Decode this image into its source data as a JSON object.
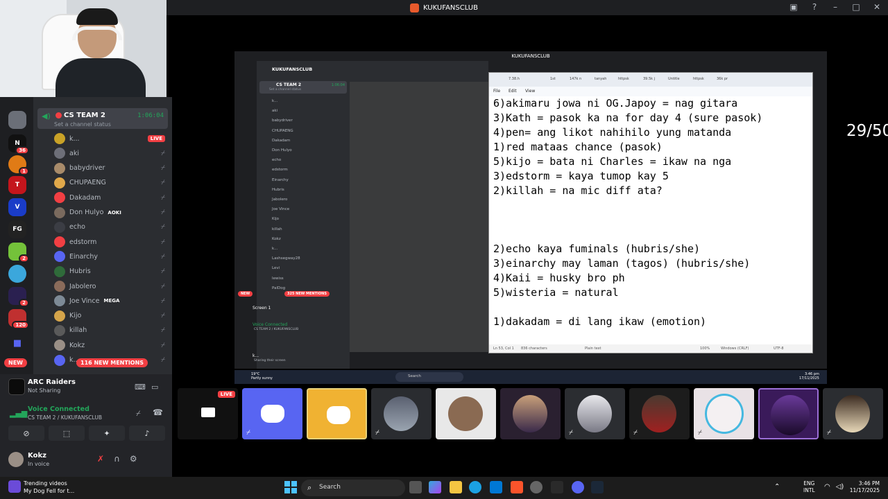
{
  "window": {
    "title": "KUKUFANSCLUB"
  },
  "sidebar": {
    "channel": {
      "name": "CS TEAM 2",
      "status": "Set a channel status",
      "time": "1:06:04"
    },
    "members": [
      {
        "name": "k...",
        "live": "LIVE",
        "color": "#c9a227"
      },
      {
        "name": "aki",
        "color": "#6d6f78"
      },
      {
        "name": "babydriver",
        "color": "#a88b6a"
      },
      {
        "name": "CHUPAENG",
        "color": "#e0a84a"
      },
      {
        "name": "Dakadam",
        "color": "#f23f43"
      },
      {
        "name": "Don Hulyo",
        "tag": "AOKI",
        "color": "#7a6a5e"
      },
      {
        "name": "echo",
        "color": "#3b3d44"
      },
      {
        "name": "edstorm",
        "color": "#f23f43"
      },
      {
        "name": "Einarchy",
        "color": "#5865f2"
      },
      {
        "name": "Hubris",
        "color": "#2f6b3a"
      },
      {
        "name": "Jabolero",
        "color": "#8a6b5a"
      },
      {
        "name": "Joe Vince",
        "tag": "MEGA",
        "color": "#7d8a96"
      },
      {
        "name": "Kijo",
        "color": "#d4a44a"
      },
      {
        "name": "killah",
        "color": "#5a5a5a"
      },
      {
        "name": "Kokz",
        "color": "#9a8f86"
      },
      {
        "name": "k...",
        "color": "#5865f2"
      }
    ],
    "new_label": "NEW",
    "mentions": "116 NEW MENTIONS",
    "server_badges": [
      "36",
      "1",
      "2",
      "2",
      "2",
      "120"
    ]
  },
  "activity": {
    "title": "ARC Raiders",
    "subtitle": "Not Sharing"
  },
  "voice": {
    "status": "Voice Connected",
    "channel": "CS TEAM 2 / KUKUFANSCLUB"
  },
  "user": {
    "name": "Kokz",
    "status": "In voice"
  },
  "shared": {
    "title": "KUKUFANSCLUB",
    "server": "KUKUFANSCLUB",
    "channel": "CS TEAM 2",
    "channel_status": "Set a channel status",
    "time": "1:06:04",
    "members": [
      "k...",
      "aki",
      "babydriver",
      "CHUPAENG",
      "Dakadam",
      "Don Hulyo",
      "echo",
      "edstorm",
      "Einarchy",
      "Hubris",
      "Jabolero",
      "Joe Vince",
      "Kijo",
      "killah",
      "Kokz",
      "k...",
      "Lashsegway28",
      "Levi",
      "lewiss",
      "PalDog"
    ],
    "mentions": "325 NEW MENTIONS",
    "new_label": "NEW",
    "screen": "Screen 1",
    "voice": "Voice Connected",
    "voice_channel": "CS TEAM 2 / KUKUFANSCLUB",
    "user": "k...",
    "user_status": "Sharing their screen",
    "weather": "19°C",
    "weather2": "Partly sunny",
    "search": "Search",
    "clock_time": "3:46 pm",
    "clock_date": "17/11/2025"
  },
  "notepad": {
    "tabs": [
      "7.38.h",
      "1st",
      "147k n",
      "tanyah",
      "httpsk",
      "39.5k j",
      "Untitle",
      "httpsk",
      "36k pr"
    ],
    "menu": [
      "File",
      "Edit",
      "View"
    ],
    "lines": [
      "6)akimaru jowa ni OG.Japoy = nag gitara",
      "3)Kath = pasok ka na for day 4 (sure pasok)",
      "4)pen= ang likot nahihilo yung matanda",
      "1)red mataas chance (pasok)",
      "5)kijo = bata ni Charles = ikaw na nga",
      "3)edstorm = kaya tumop kay 5",
      "2)killah = na mic diff ata?",
      "",
      "",
      "",
      "2)echo kaya fuminals (hubris/she)",
      "3)einarchy may laman (tagos) (hubris/she)",
      "4)Kaii = husky bro ph",
      "5)wisteria = natural",
      "",
      "1)dakadam = di lang ikaw (emotion)"
    ],
    "status": {
      "pos": "Ln 53, Col 1",
      "chars": "836 characters",
      "type": "Plain text",
      "zoom": "100%",
      "eol": "Windows (CRLF)",
      "enc": "UTF-8"
    }
  },
  "overlay": {
    "text": "29/500"
  },
  "tiles": [
    {
      "live": "LIVE"
    },
    {},
    {},
    {},
    {},
    {},
    {},
    {},
    {},
    {},
    {}
  ],
  "taskbar": {
    "trend_title": "Trending videos",
    "trend_sub": "My Dog Fell for t...",
    "search": "Search",
    "lang1": "ENG",
    "lang2": "INTL",
    "time": "3:46 PM",
    "date": "11/17/2025"
  }
}
